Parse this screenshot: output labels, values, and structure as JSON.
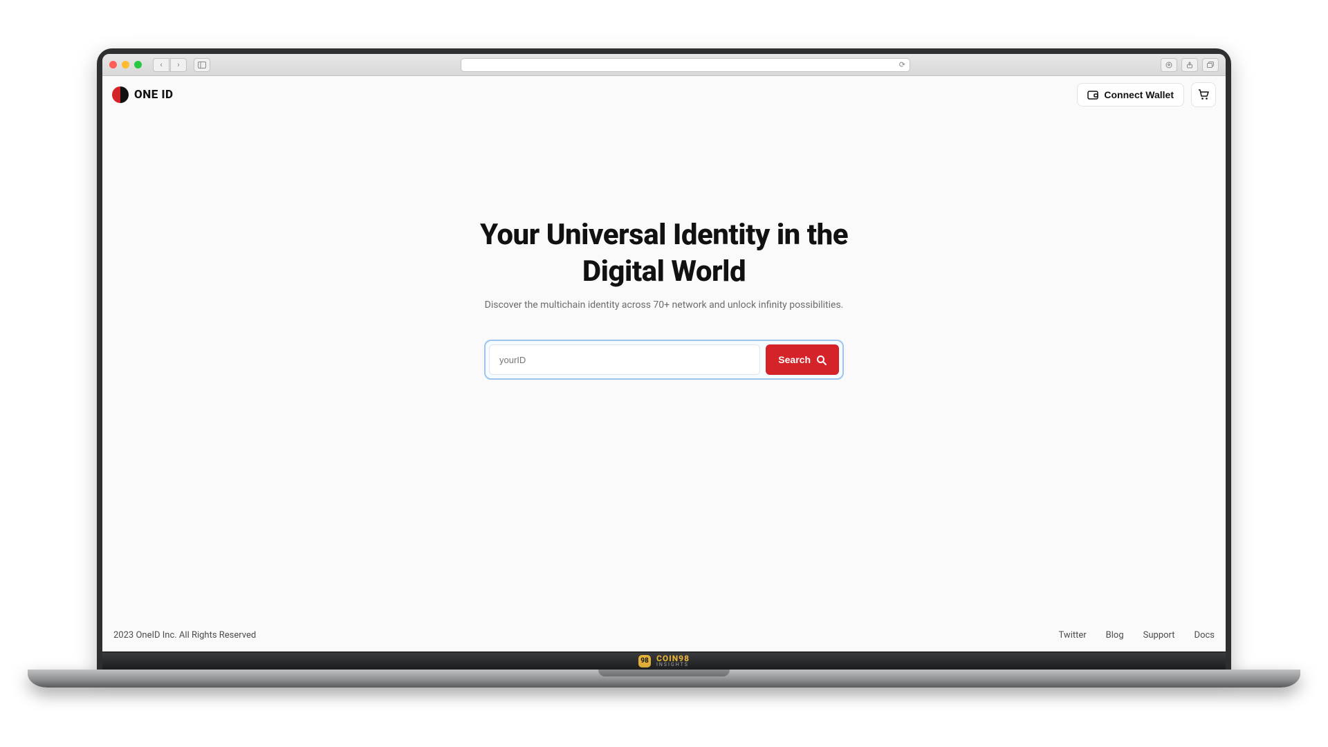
{
  "brand": {
    "name": "ONE ID"
  },
  "header": {
    "connect_label": "Connect Wallet"
  },
  "hero": {
    "title_line1": "Your Universal Identity in the",
    "title_line2": "Digital World",
    "subtitle": "Discover the multichain identity across 70+ network and unlock infinity possibilities."
  },
  "search": {
    "placeholder": "yourID",
    "button_label": "Search"
  },
  "footer": {
    "copyright": "2023 OneID Inc. All Rights Reserved",
    "links": [
      "Twitter",
      "Blog",
      "Support",
      "Docs"
    ]
  },
  "hinge": {
    "mark": "98",
    "main": "COIN98",
    "sub": "INSIGHTS"
  }
}
